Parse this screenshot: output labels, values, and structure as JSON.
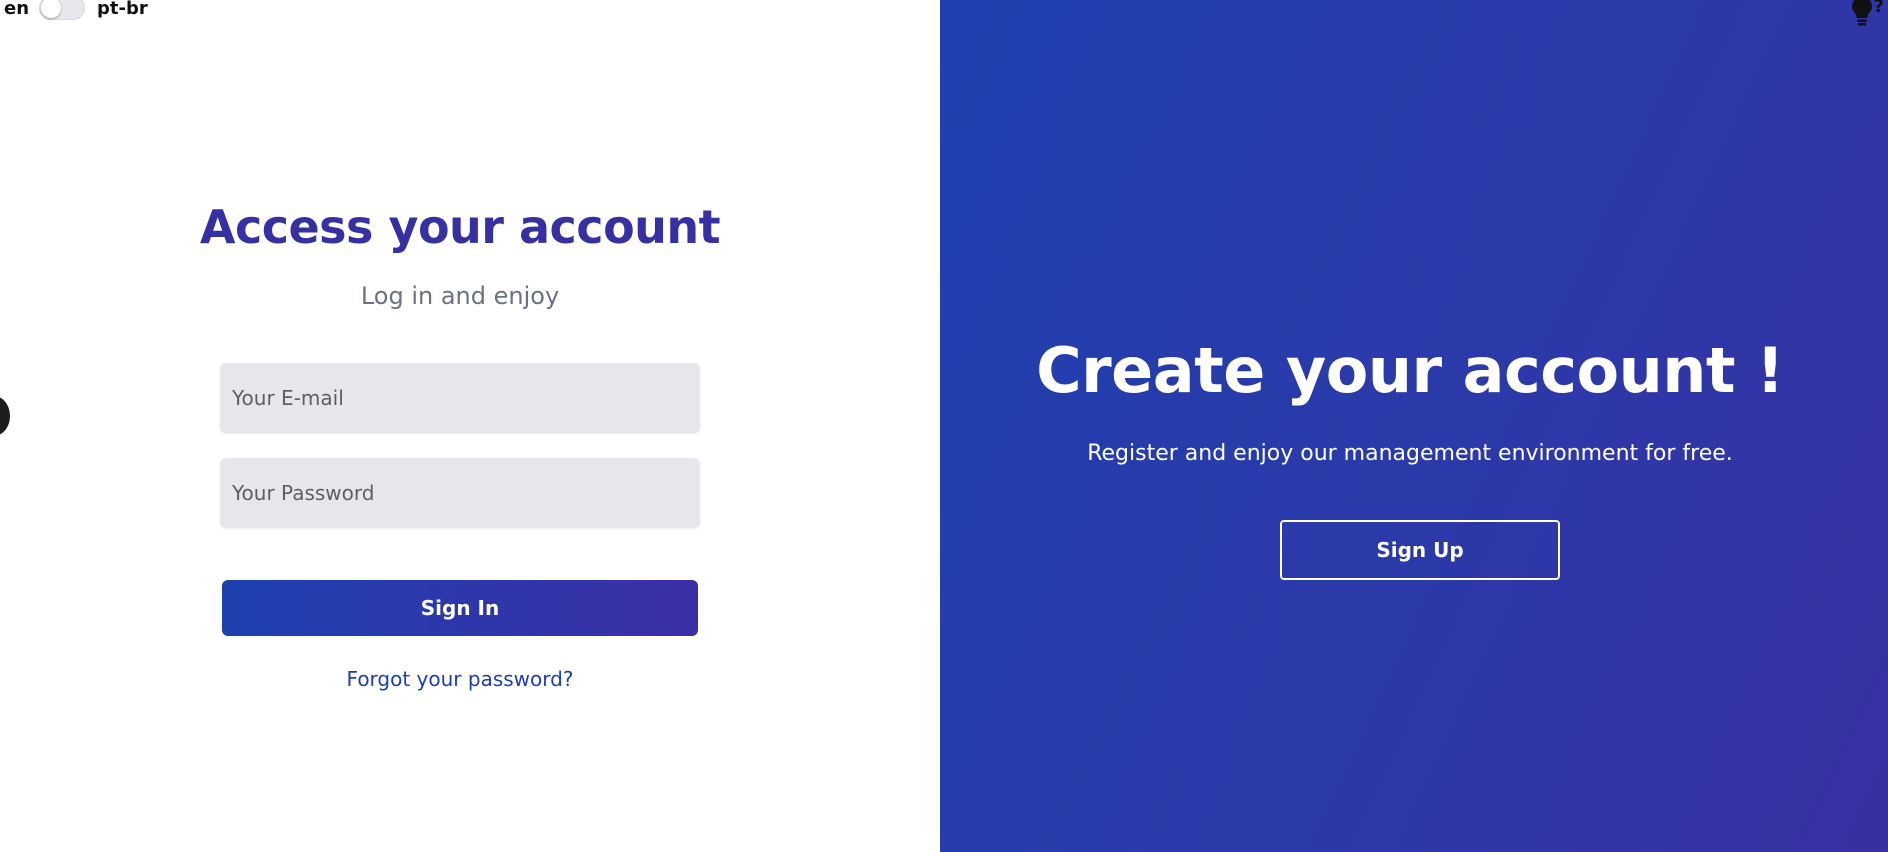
{
  "language_toggle": {
    "left_label": "en",
    "right_label": "pt-br"
  },
  "login": {
    "title": "Access your account",
    "subtitle": "Log in and enjoy",
    "email_placeholder": "Your E-mail",
    "password_placeholder": "Your Password",
    "submit_label": "Sign In",
    "forgot_link": "Forgot your password?"
  },
  "signup": {
    "title": "Create your account !",
    "subtitle": "Register and enjoy our management environment for free.",
    "button_label": "Sign Up"
  },
  "hint": {
    "icon": "lightbulb-icon",
    "mark": "?"
  },
  "colors": {
    "primary": "#3730a3",
    "accent_blue": "#1e40af",
    "input_bg": "#e6e7eb",
    "muted_text": "#6b7280"
  }
}
